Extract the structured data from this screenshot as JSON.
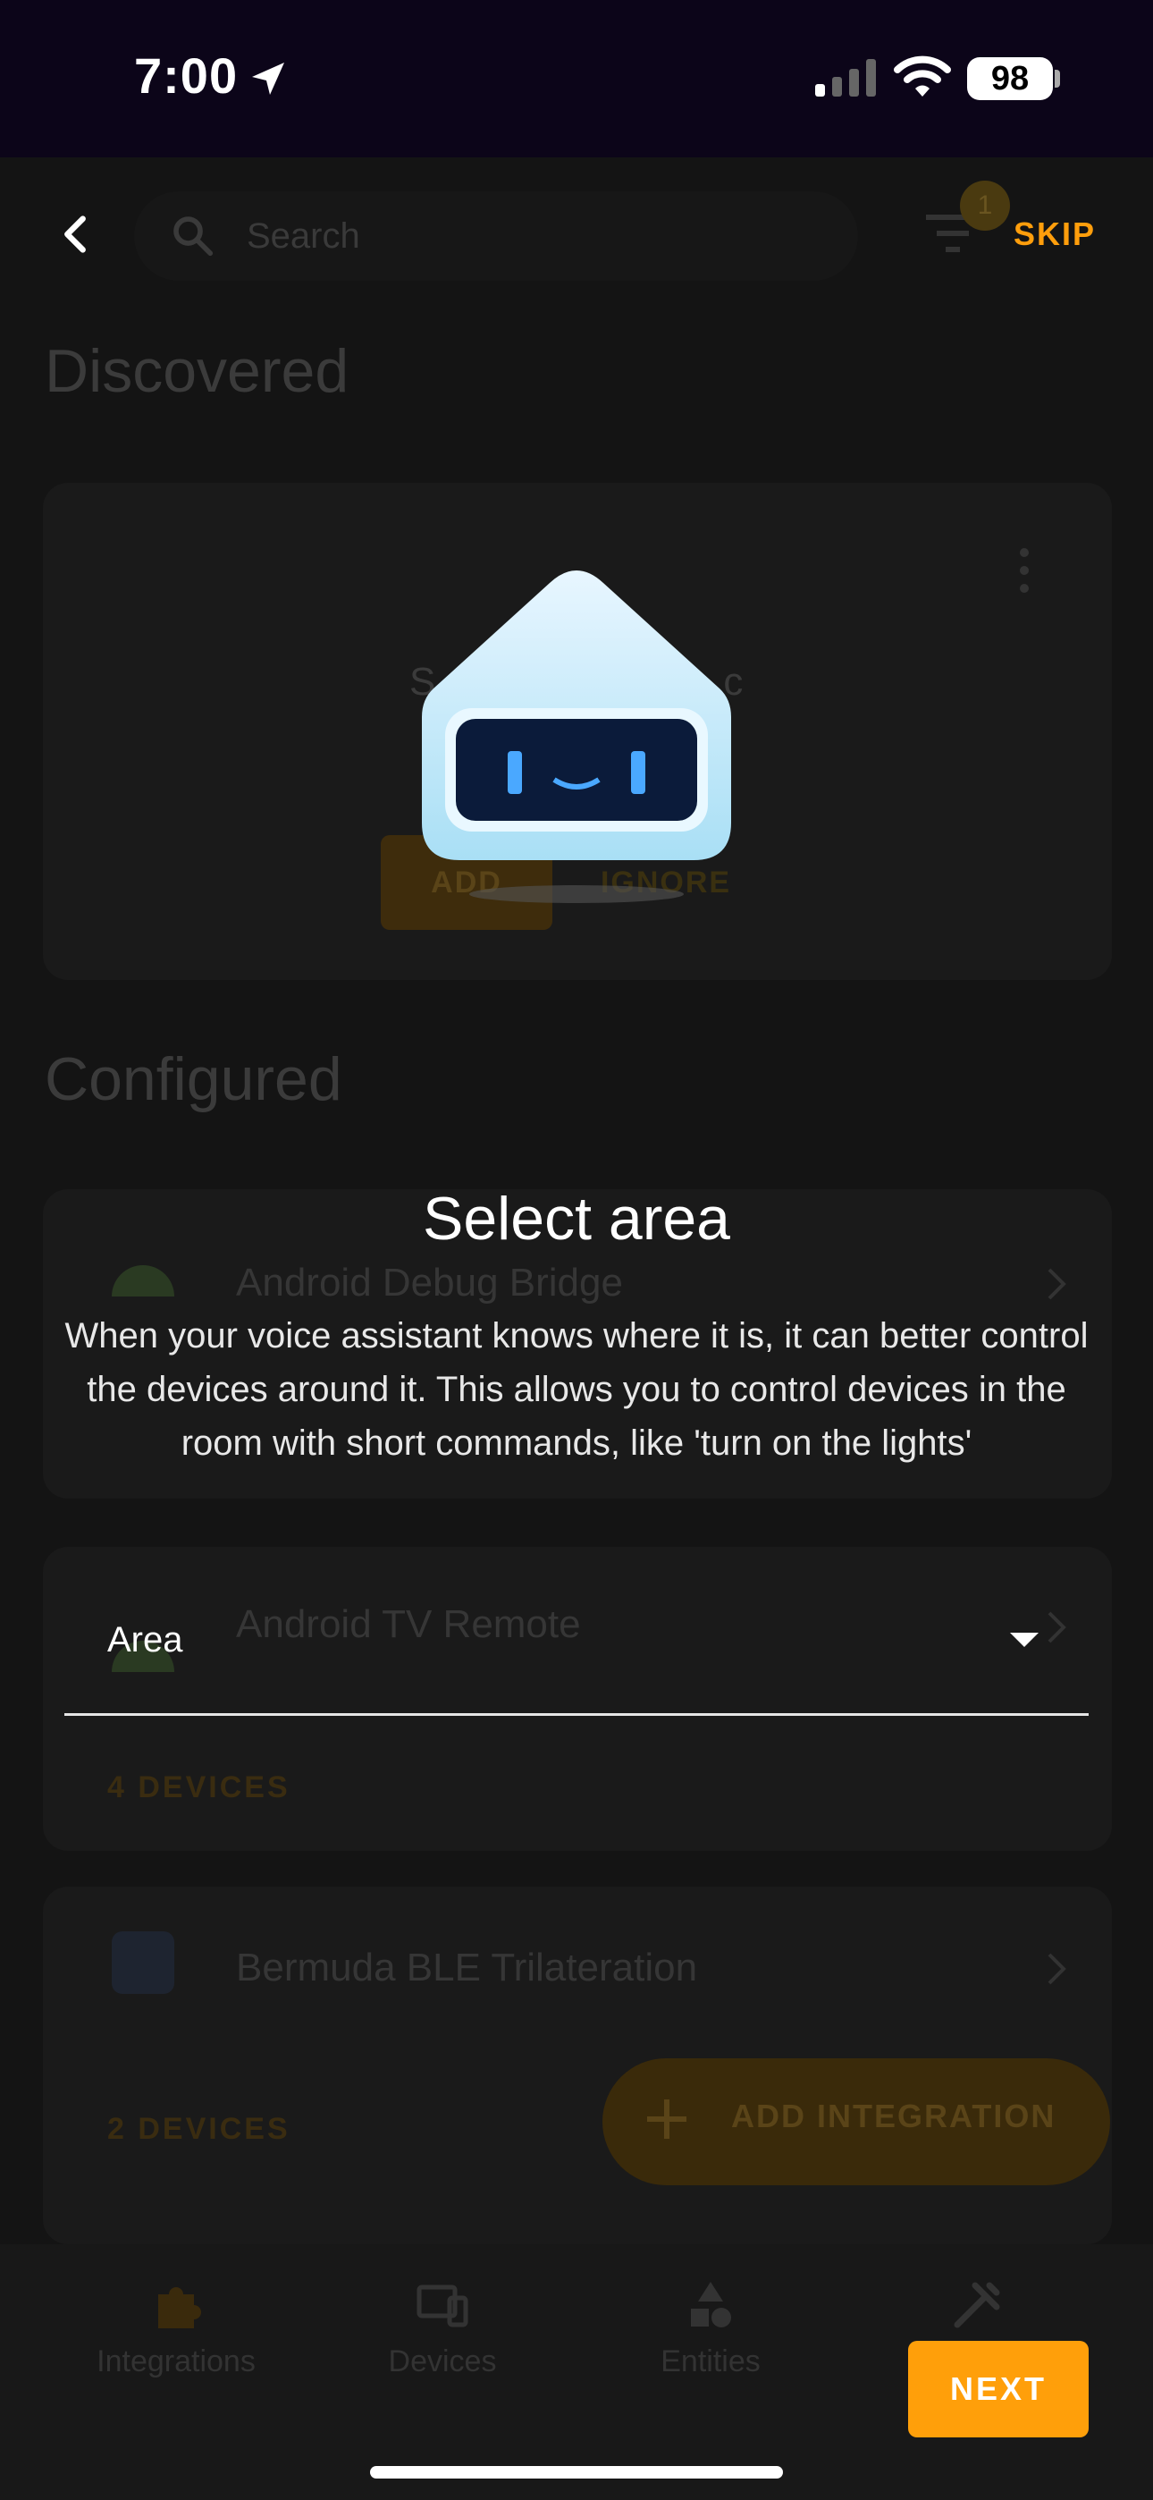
{
  "status_bar": {
    "time": "7:00",
    "battery": "98"
  },
  "background": {
    "search_placeholder": "Search",
    "filter_badge": "1",
    "skip_label": "SKIP",
    "discovered_heading": "Discovered",
    "discovered_card": {
      "name": "S",
      "name_tail": "c",
      "add_label": "ADD",
      "ignore_label": "IGNORE"
    },
    "configured_heading": "Configured",
    "integrations": [
      {
        "name": "Android Debug Bridge"
      },
      {
        "name": "Android TV Remote",
        "devices": "4 DEVICES"
      },
      {
        "name": "Bermuda BLE Trilateration",
        "devices": "2 DEVICES"
      }
    ],
    "add_integration_label": "ADD INTEGRATION",
    "nav": [
      {
        "label": "Integrations",
        "icon": "puzzle-icon"
      },
      {
        "label": "Devices",
        "icon": "devices-icon"
      },
      {
        "label": "Entities",
        "icon": "shapes-icon"
      },
      {
        "label": "",
        "icon": "tools-icon"
      }
    ]
  },
  "dialog": {
    "title": "Select area",
    "description": "When your voice assistant knows where it is, it can better control the devices around it. This allows you to control devices in the room with short commands, like 'turn on the lights'",
    "area_label": "Area",
    "next_label": "NEXT"
  },
  "colors": {
    "accent": "#ff9f0a",
    "background": "#141414",
    "status_bar": "#0c0519"
  }
}
